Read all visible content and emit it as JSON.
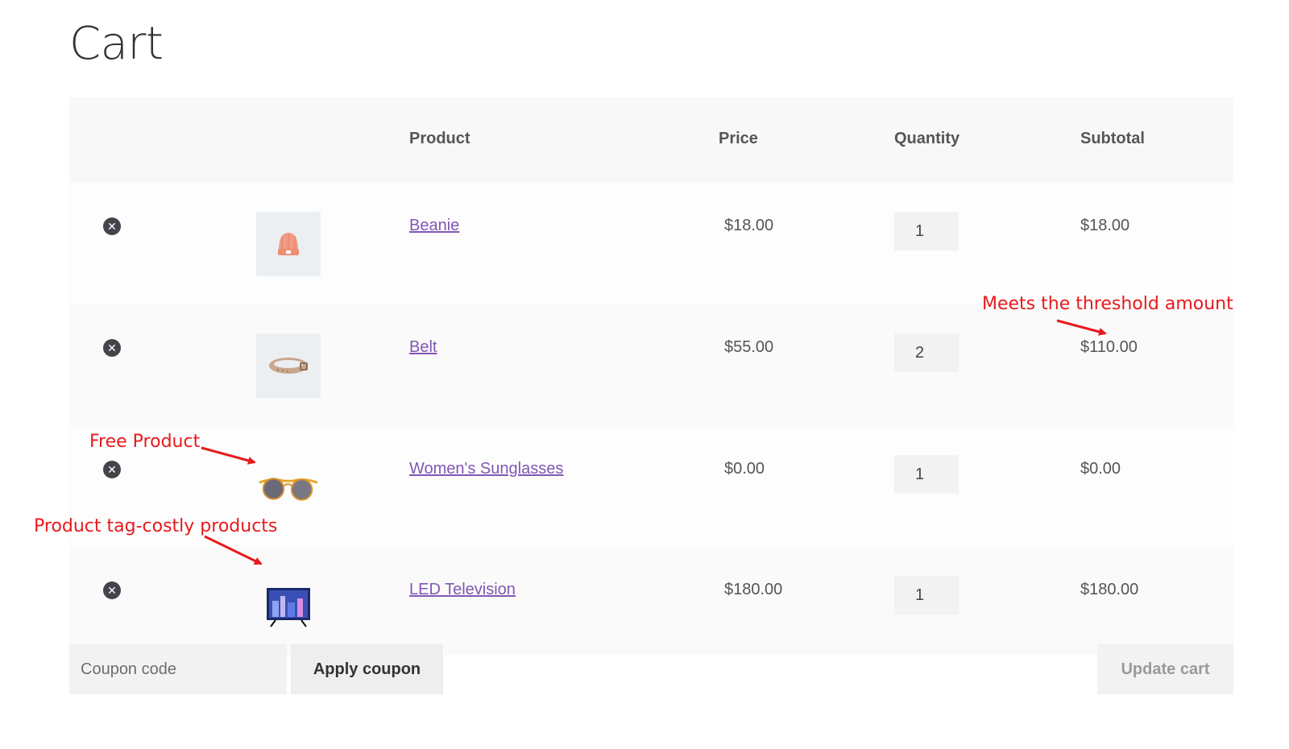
{
  "page": {
    "title": "Cart"
  },
  "table": {
    "headers": {
      "product": "Product",
      "price": "Price",
      "quantity": "Quantity",
      "subtotal": "Subtotal"
    },
    "rows": [
      {
        "name": "Beanie",
        "price": "$18.00",
        "quantity": "1",
        "subtotal": "$18.00",
        "thumb_icon": "beanie-icon"
      },
      {
        "name": "Belt",
        "price": "$55.00",
        "quantity": "2",
        "subtotal": "$110.00",
        "thumb_icon": "belt-icon"
      },
      {
        "name": "Women's Sunglasses",
        "price": "$0.00",
        "quantity": "1",
        "subtotal": "$0.00",
        "thumb_icon": "sunglasses-icon"
      },
      {
        "name": "LED Television",
        "price": "$180.00",
        "quantity": "1",
        "subtotal": "$180.00",
        "thumb_icon": "television-icon"
      }
    ]
  },
  "actions": {
    "coupon_placeholder": "Coupon code",
    "apply_coupon_label": "Apply coupon",
    "update_cart_label": "Update cart"
  },
  "annotations": {
    "threshold": "Meets the threshold amount",
    "free_product": "Free Product",
    "product_tag": "Product tag-costly products"
  },
  "colors": {
    "link": "#8157b4",
    "annotation": "#e8191c",
    "header_bg": "#f8f8f8",
    "remove_icon": "#43454b"
  }
}
